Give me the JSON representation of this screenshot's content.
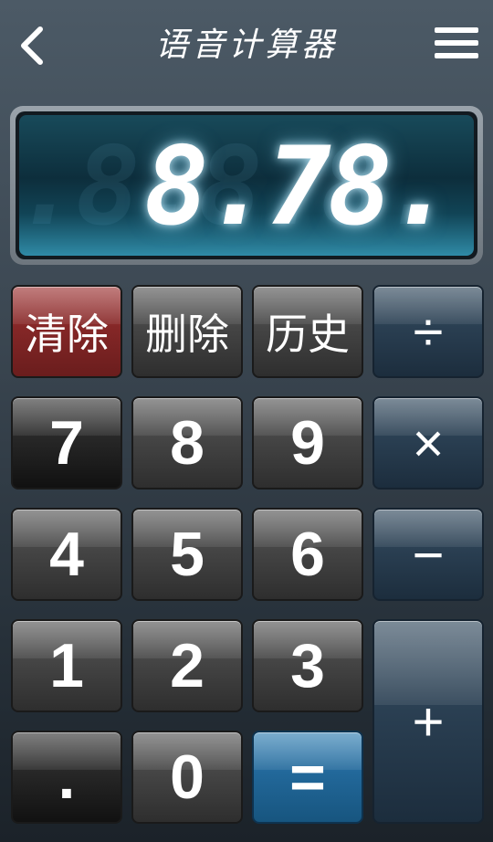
{
  "header": {
    "title": "语音计算器",
    "back_icon": "chevron-left-icon",
    "menu_icon": "hamburger-menu-icon"
  },
  "display": {
    "value": "8.78.",
    "ghost": "8.8.8.8.8.8."
  },
  "keys": {
    "clear": "清除",
    "delete": "删除",
    "history": "历史",
    "divide": "÷",
    "seven": "7",
    "eight": "8",
    "nine": "9",
    "multiply": "×",
    "four": "4",
    "five": "5",
    "six": "6",
    "minus": "−",
    "one": "1",
    "two": "2",
    "three": "3",
    "plus": "+",
    "dot": ".",
    "zero": "0",
    "equals": "="
  },
  "colors": {
    "clear_key": "#852727",
    "operator_key": "#2a3f52",
    "equals_key": "#22689a",
    "display_glow": "#82d2f0"
  }
}
